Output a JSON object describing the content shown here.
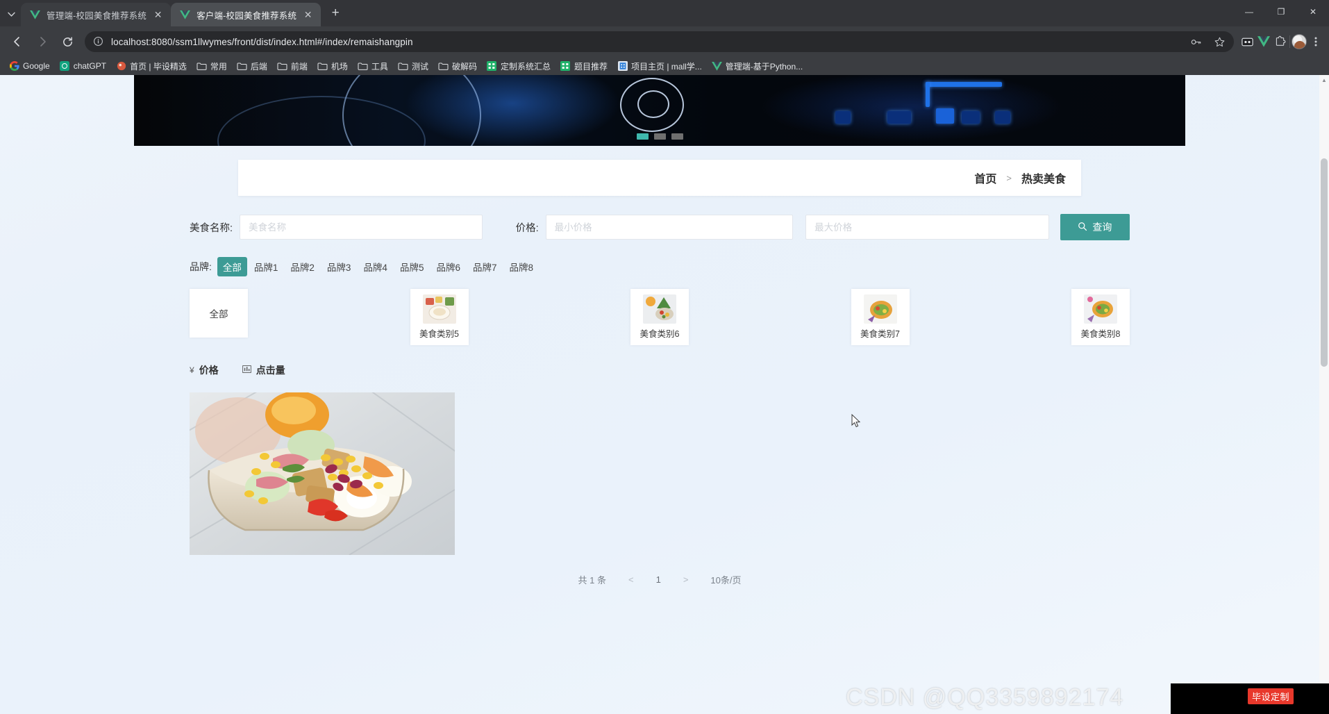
{
  "browser": {
    "tabs": [
      {
        "title": "管理端-校园美食推荐系统",
        "favicon": "vue-logo-icon",
        "active": false
      },
      {
        "title": "客户端-校园美食推荐系统",
        "favicon": "vue-logo-icon",
        "active": true
      }
    ],
    "newtab_label": "+",
    "close_label": "✕",
    "nav": {
      "back": "←",
      "forward": "→",
      "reload": "↻"
    },
    "omnibox": {
      "url": "localhost:8080/ssm1llwymes/front/dist/index.html#/index/remaishangpin",
      "info_icon": "info-circle-icon"
    },
    "toolbar_icons": [
      "key-icon",
      "star-icon",
      "reading-list-icon",
      "vue-devtools-icon",
      "extensions-puzzle-icon",
      "profile-avatar-icon",
      "kebab-menu-icon"
    ],
    "window_controls": {
      "minimize": "—",
      "maximize": "❐",
      "close": "✕"
    },
    "bookmarks": [
      {
        "label": "Google",
        "icon": "google-icon"
      },
      {
        "label": "chatGPT",
        "icon": "chatgpt-icon"
      },
      {
        "label": "首页 | 毕设精选",
        "icon": "site-icon"
      },
      {
        "label": "常用",
        "icon": "folder-icon"
      },
      {
        "label": "后端",
        "icon": "folder-icon"
      },
      {
        "label": "前端",
        "icon": "folder-icon"
      },
      {
        "label": "机场",
        "icon": "folder-icon"
      },
      {
        "label": "工具",
        "icon": "folder-icon"
      },
      {
        "label": "测试",
        "icon": "folder-icon"
      },
      {
        "label": "破解码",
        "icon": "folder-icon"
      },
      {
        "label": "定制系统汇总",
        "icon": "green-grid-icon"
      },
      {
        "label": "题目推荐",
        "icon": "green-grid-icon"
      },
      {
        "label": "项目主页 | mall学...",
        "icon": "blue-site-icon"
      },
      {
        "label": "管理端-基于Python...",
        "icon": "vue-logo-icon"
      }
    ]
  },
  "page": {
    "banner": {
      "dots": 3,
      "active_dot": 0
    },
    "breadcrumb": {
      "home": "首页",
      "separator": ">",
      "current": "热卖美食"
    },
    "filters": {
      "name_label": "美食名称:",
      "name_placeholder": "美食名称",
      "name_value": "",
      "price_label": "价格:",
      "price_min_placeholder": "最小价格",
      "price_min_value": "",
      "price_max_placeholder": "最大价格",
      "price_max_value": "",
      "search_button": "查询",
      "search_icon": "search-icon"
    },
    "brand": {
      "label": "品牌:",
      "options": [
        "全部",
        "品牌1",
        "品牌2",
        "品牌3",
        "品牌4",
        "品牌5",
        "品牌6",
        "品牌7",
        "品牌8"
      ],
      "selected": "全部"
    },
    "categories": [
      {
        "name": "全部",
        "has_image": false
      },
      {
        "name": "美食类别5",
        "has_image": true
      },
      {
        "name": "美食类别6",
        "has_image": true
      },
      {
        "name": "美食类别7",
        "has_image": true
      },
      {
        "name": "美食类别8",
        "has_image": true
      }
    ],
    "sort": [
      {
        "label": "价格",
        "icon": "yen-icon"
      },
      {
        "label": "点击量",
        "icon": "chart-icon"
      }
    ],
    "goods": [
      {
        "image_alt": "沙拉便当美食图片"
      }
    ],
    "pagination": {
      "total": "共 1 条",
      "prev": "<",
      "pages": [
        "1"
      ],
      "next": ">",
      "page_size": "10条/页"
    }
  },
  "watermark": {
    "text": "CSDN @QQ3359892174",
    "badge": "毕设定制"
  },
  "colors": {
    "accent": "#3d9b95",
    "page_bg": "#eaf2fb",
    "chrome_bg": "#3b3d41",
    "tab_active": "#4c4f53",
    "badge_red": "#e8382b"
  }
}
